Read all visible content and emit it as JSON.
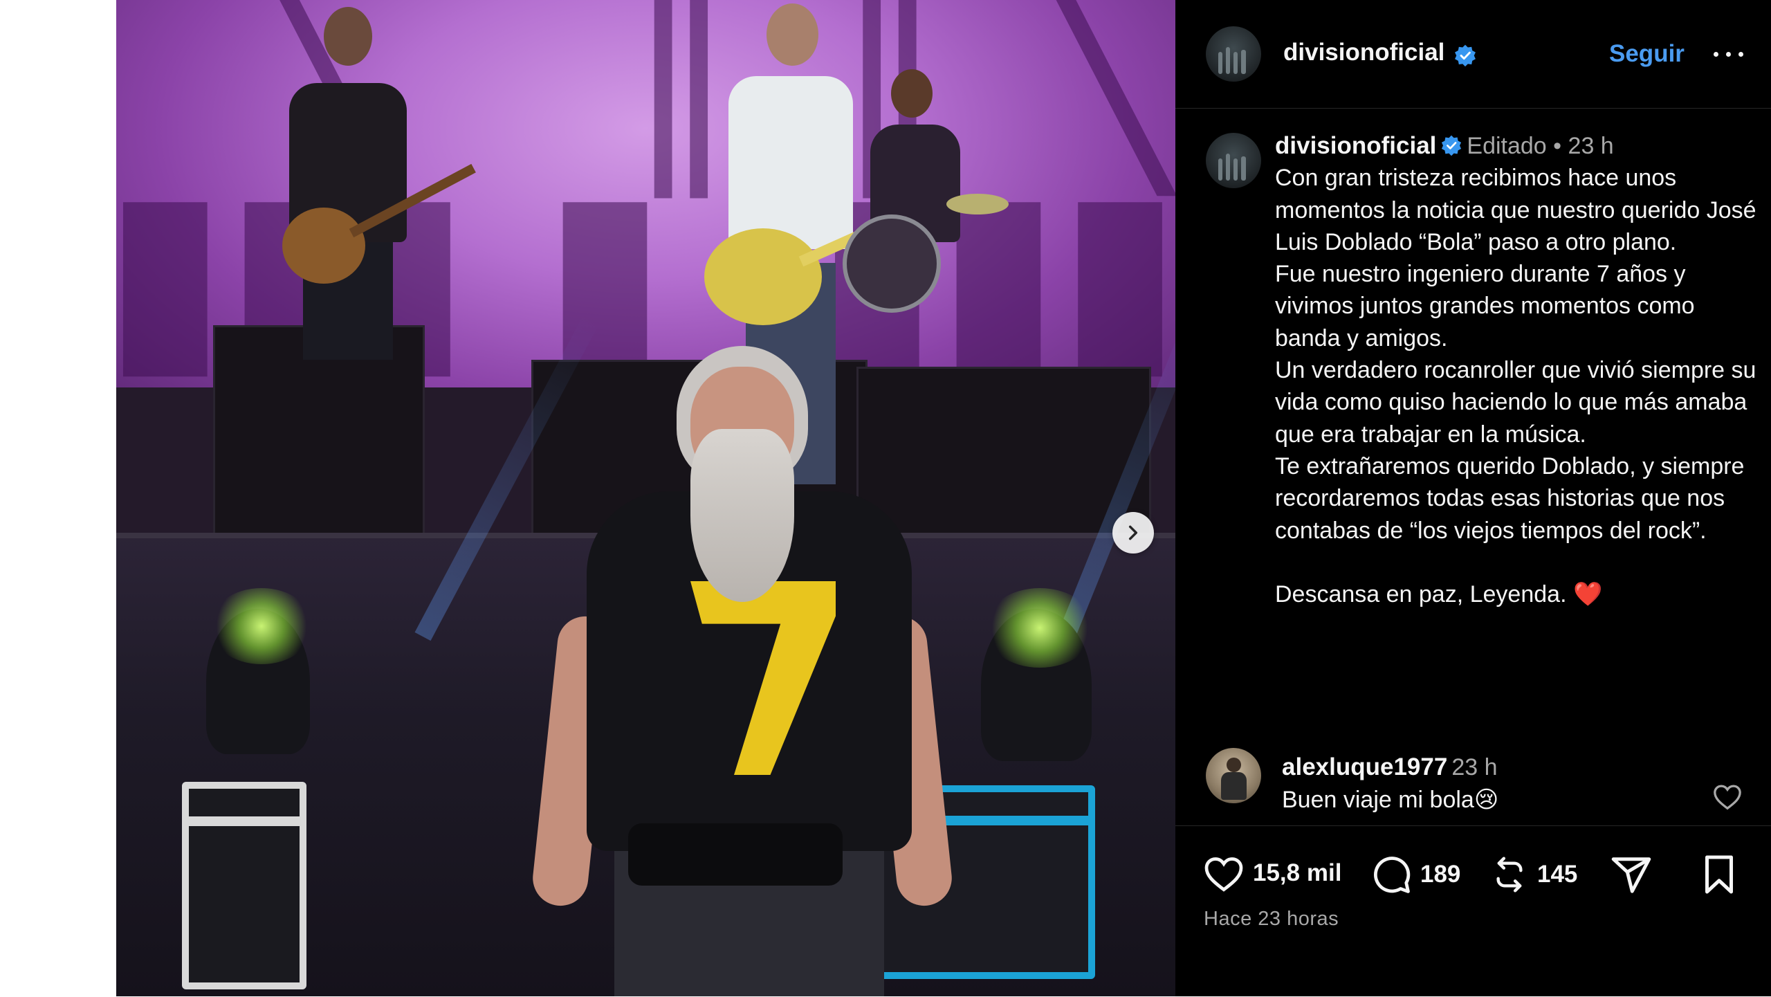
{
  "post": {
    "image_alt": "",
    "next_button_icon": "chevron-right-icon"
  },
  "header": {
    "username": "divisionoficial",
    "follow_label": "Seguir",
    "more_icon": "more-dots-icon"
  },
  "caption": {
    "username": "divisionoficial",
    "edited_label": "Editado",
    "separator": "•",
    "time": "23 h",
    "paragraphs": [
      "Con gran tristeza recibimos hace unos momentos la noticia que nuestro querido José Luis Doblado “Bola” paso a otro plano.",
      "Fue nuestro ingeniero durante 7 años y vivimos juntos grandes momentos como banda y amigos.",
      "Un verdadero rocanroller que vivió siempre su vida como quiso haciendo lo que más amaba que era trabajar en la música.",
      "Te extrañaremos querido Doblado, y siempre recordaremos todas esas historias que nos contabas de “los viejos tiempos del rock”.",
      "Descansa en paz, Leyenda."
    ],
    "closing_emoji": "❤️"
  },
  "comment": {
    "username": "alexluque1977",
    "time": "23 h",
    "text": "Buen viaje mi bola",
    "emoji": "😢"
  },
  "actions": {
    "likes": "15,8 mil",
    "comments": "189",
    "reposts": "145",
    "posted": "Hace 23 horas"
  },
  "colors": {
    "panel_bg": "#000000",
    "follow_blue": "#4a9bf0",
    "verified_blue": "#3897f0",
    "muted_text": "#a8a8a8",
    "heart_red": "#e0245e"
  }
}
